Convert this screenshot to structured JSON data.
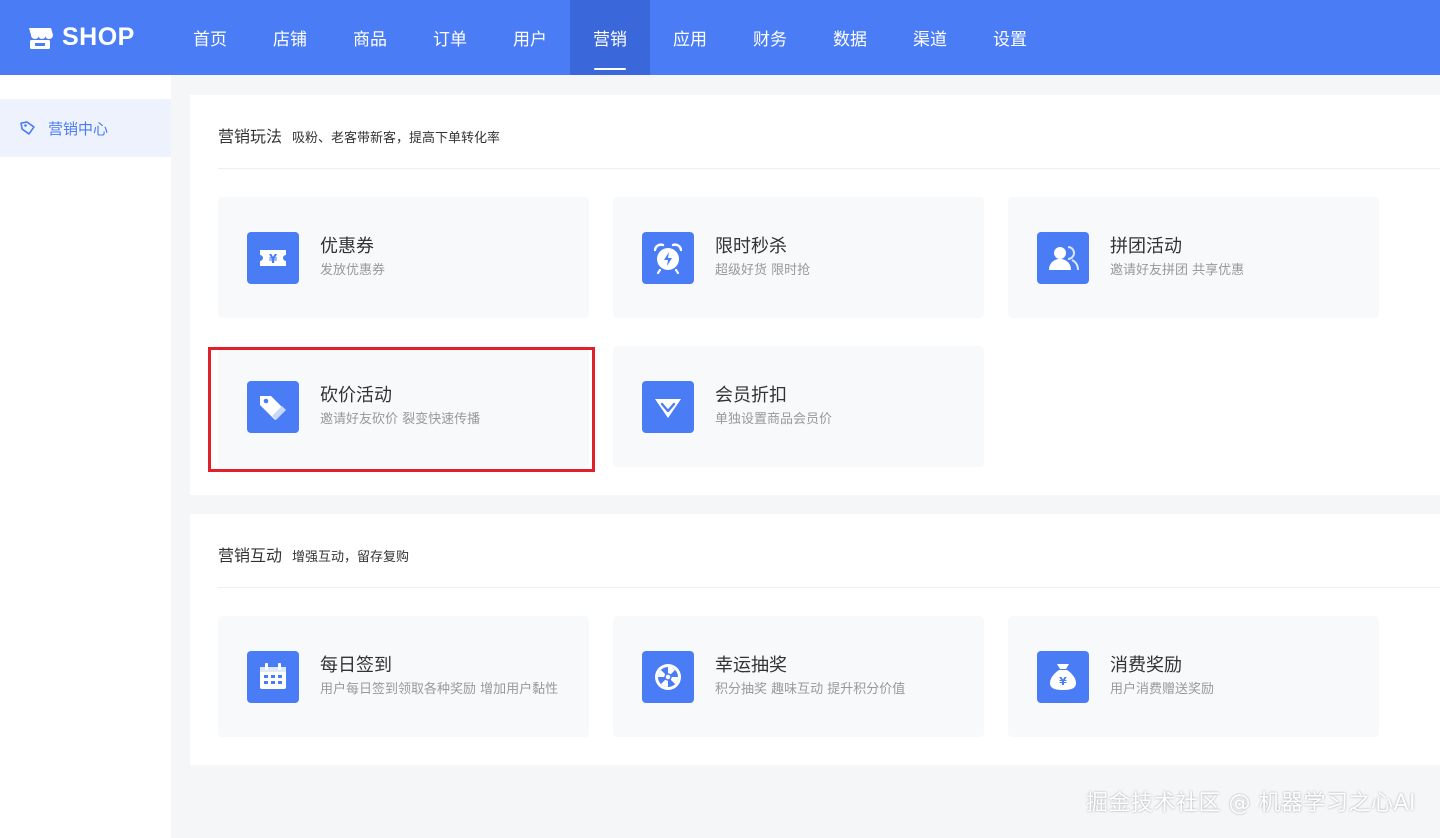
{
  "brand": {
    "name": "SHOP"
  },
  "nav": {
    "items": [
      "首页",
      "店铺",
      "商品",
      "订单",
      "用户",
      "营销",
      "应用",
      "财务",
      "数据",
      "渠道",
      "设置"
    ],
    "active": "营销"
  },
  "sidebar": {
    "items": [
      {
        "label": "营销中心",
        "icon": "tag-icon"
      }
    ]
  },
  "sections": [
    {
      "title": "营销玩法",
      "subtitle": "吸粉、老客带新客，提高下单转化率",
      "cards": [
        {
          "title": "优惠券",
          "desc": "发放优惠券",
          "icon": "coupon-icon"
        },
        {
          "title": "限时秒杀",
          "desc": "超级好货 限时抢",
          "icon": "alarm-clock-icon"
        },
        {
          "title": "拼团活动",
          "desc": "邀请好友拼团 共享优惠",
          "icon": "group-users-icon"
        },
        {
          "title": "砍价活动",
          "desc": "邀请好友砍价 裂变快速传播",
          "icon": "price-tag-icon"
        },
        {
          "title": "会员折扣",
          "desc": "单独设置商品会员价",
          "icon": "diamond-icon"
        }
      ]
    },
    {
      "title": "营销互动",
      "subtitle": "增强互动，留存复购",
      "cards": [
        {
          "title": "每日签到",
          "desc": "用户每日签到领取各种奖励 增加用户黏性",
          "icon": "calendar-icon"
        },
        {
          "title": "幸运抽奖",
          "desc": "积分抽奖 趣味互动 提升积分价值",
          "icon": "lucky-wheel-icon"
        },
        {
          "title": "消费奖励",
          "desc": "用户消费赠送奖励",
          "icon": "money-bag-icon"
        }
      ]
    }
  ],
  "watermark": "掘金技术社区 @ 机器学习之心AI",
  "colors": {
    "primary": "#4a7cf6",
    "nav_active": "#3a67d9",
    "highlight": "#e0202a"
  }
}
